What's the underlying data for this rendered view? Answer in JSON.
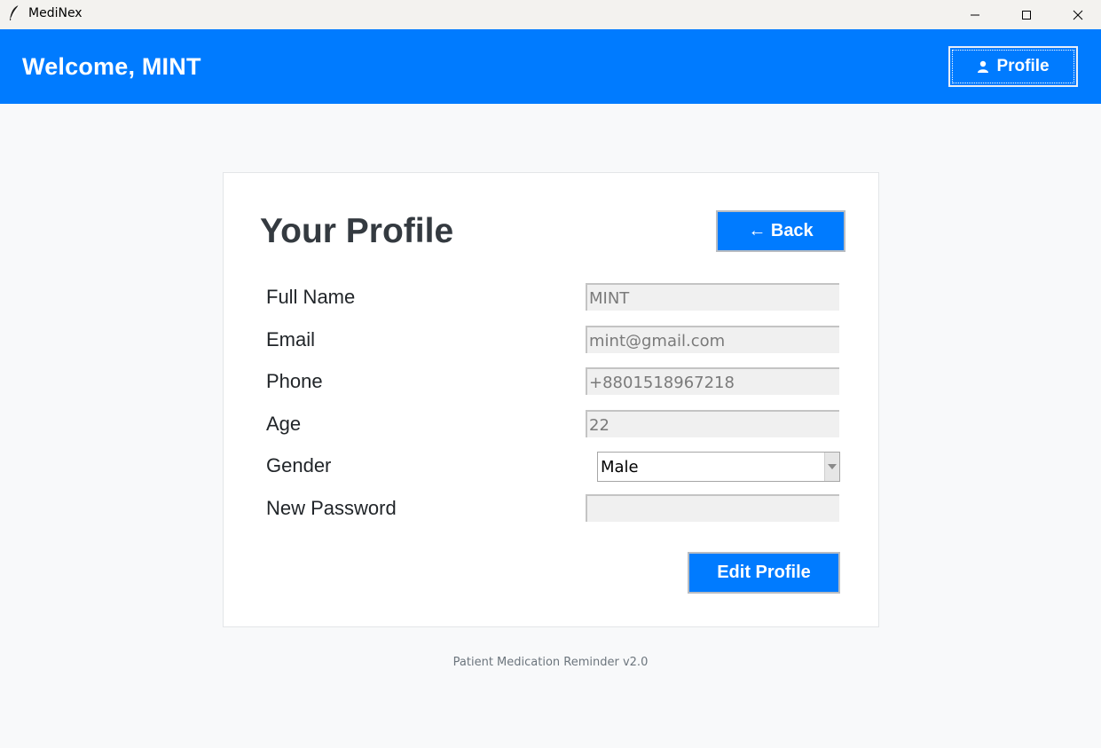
{
  "window": {
    "title": "MediNex",
    "app_icon": "feather-icon",
    "controls": [
      "minimize-icon",
      "maximize-icon",
      "close-icon"
    ]
  },
  "header": {
    "welcome": "Welcome, MINT",
    "profile_button": {
      "icon": "user-icon",
      "label": "Profile"
    }
  },
  "profile": {
    "title": "Your Profile",
    "back_button": "← Back",
    "fields": {
      "full_name": {
        "label": "Full Name",
        "value": "MINT"
      },
      "email": {
        "label": "Email",
        "value": "mint@gmail.com"
      },
      "phone": {
        "label": "Phone",
        "value": "+8801518967218"
      },
      "age": {
        "label": "Age",
        "value": "22"
      },
      "gender": {
        "label": "Gender",
        "value": "Male"
      },
      "new_password": {
        "label": "New Password",
        "value": ""
      }
    },
    "edit_button": "Edit Profile"
  },
  "footer": "Patient Medication Reminder v2.0",
  "colors": {
    "brand": "#007bff",
    "background": "#f8f9fa",
    "card": "#ffffff",
    "text_dark": "#343a40",
    "input_bg": "#f0f0f0"
  }
}
